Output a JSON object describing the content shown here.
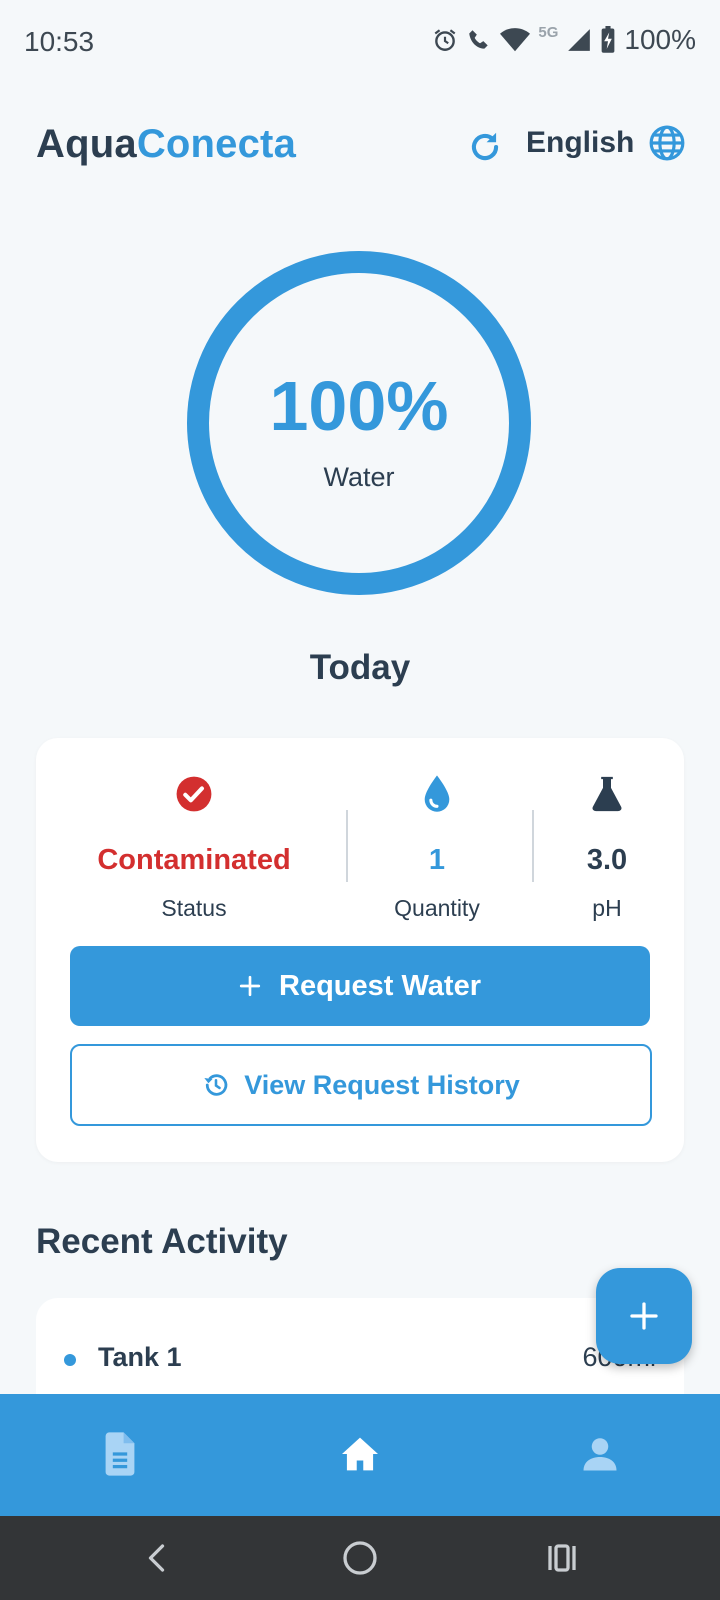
{
  "status_bar": {
    "time": "10:53",
    "battery": "100%",
    "network": "5G"
  },
  "header": {
    "title_part1": "Aqua",
    "title_part2": "Conecta",
    "language": "English"
  },
  "gauge": {
    "percent_text": "100%",
    "label": "Water",
    "level": 1.0
  },
  "section_today": "Today",
  "stats": {
    "status": {
      "value": "Contaminated",
      "label": "Status"
    },
    "quantity": {
      "value": "1",
      "label": "Quantity"
    },
    "ph": {
      "value": "3.0",
      "label": "pH"
    }
  },
  "buttons": {
    "request_water": "Request Water",
    "view_history": "View Request History"
  },
  "recent": {
    "title": "Recent Activity",
    "items": [
      {
        "name": "Tank 1",
        "amount": "600ml"
      }
    ]
  },
  "colors": {
    "accent": "#3498db",
    "danger": "#d32f2f",
    "text": "#2c3e50"
  },
  "icons": {
    "refresh": "refresh-icon",
    "language": "globe-icon",
    "status": "check-circle-icon",
    "quantity": "water-drop-icon",
    "ph": "flask-icon",
    "history": "history-icon",
    "fab": "plus-icon",
    "nav": [
      "document-icon",
      "home-icon",
      "user-icon"
    ]
  }
}
